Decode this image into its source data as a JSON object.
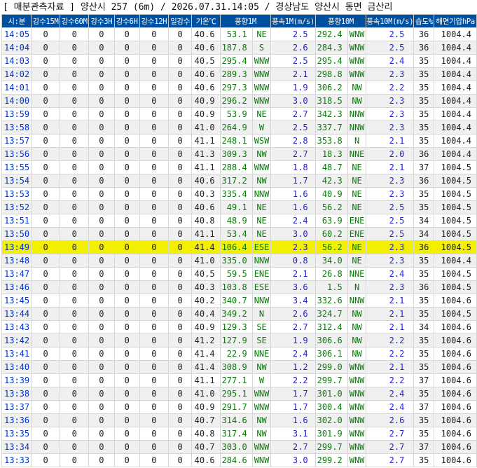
{
  "title": "[ 매분관측자료 ] 양산시 257 (6m) / 2026.07.31.14:05 / 경상남도 양산시 동면 금산리",
  "headers": [
    "시:분",
    "강수15M",
    "강수60M",
    "강수3H",
    "강수6H",
    "강수12H",
    "일강수",
    "기온℃",
    "풍향1M",
    "풍속1M(m/s)",
    "풍향10M",
    "풍속10M(m/s)",
    "습도%",
    "해면기압hPa"
  ],
  "highlight_time": "13:49",
  "rows": [
    [
      "14:05",
      "0",
      "0",
      "0",
      "0",
      "0",
      "0",
      "40.6",
      "53.1",
      "NE",
      "2.5",
      "292.4",
      "WNW",
      "2.5",
      "36",
      "1004.4"
    ],
    [
      "14:04",
      "0",
      "0",
      "0",
      "0",
      "0",
      "0",
      "40.6",
      "187.8",
      "S",
      "2.6",
      "284.3",
      "WNW",
      "2.5",
      "36",
      "1004.4"
    ],
    [
      "14:03",
      "0",
      "0",
      "0",
      "0",
      "0",
      "0",
      "40.5",
      "295.4",
      "WNW",
      "2.5",
      "295.4",
      "WNW",
      "2.4",
      "35",
      "1004.4"
    ],
    [
      "14:02",
      "0",
      "0",
      "0",
      "0",
      "0",
      "0",
      "40.6",
      "289.3",
      "WNW",
      "2.1",
      "298.8",
      "WNW",
      "2.3",
      "35",
      "1004.4"
    ],
    [
      "14:01",
      "0",
      "0",
      "0",
      "0",
      "0",
      "0",
      "40.6",
      "297.3",
      "WNW",
      "1.9",
      "306.2",
      "NW",
      "2.2",
      "35",
      "1004.4"
    ],
    [
      "14:00",
      "0",
      "0",
      "0",
      "0",
      "0",
      "0",
      "40.9",
      "296.2",
      "WNW",
      "3.0",
      "318.5",
      "NW",
      "2.3",
      "35",
      "1004.4"
    ],
    [
      "13:59",
      "0",
      "0",
      "0",
      "0",
      "0",
      "0",
      "40.9",
      "53.9",
      "NE",
      "2.7",
      "342.3",
      "NNW",
      "2.3",
      "35",
      "1004.4"
    ],
    [
      "13:58",
      "0",
      "0",
      "0",
      "0",
      "0",
      "0",
      "41.0",
      "264.9",
      "W",
      "2.5",
      "337.7",
      "NNW",
      "2.3",
      "35",
      "1004.4"
    ],
    [
      "13:57",
      "0",
      "0",
      "0",
      "0",
      "0",
      "0",
      "41.1",
      "248.1",
      "WSW",
      "2.8",
      "353.8",
      "N",
      "2.1",
      "35",
      "1004.4"
    ],
    [
      "13:56",
      "0",
      "0",
      "0",
      "0",
      "0",
      "0",
      "41.3",
      "309.3",
      "NW",
      "2.7",
      "18.3",
      "NNE",
      "2.0",
      "36",
      "1004.4"
    ],
    [
      "13:55",
      "0",
      "0",
      "0",
      "0",
      "0",
      "0",
      "41.1",
      "288.4",
      "WNW",
      "1.8",
      "48.7",
      "NE",
      "2.1",
      "37",
      "1004.5"
    ],
    [
      "13:54",
      "0",
      "0",
      "0",
      "0",
      "0",
      "0",
      "40.6",
      "317.2",
      "NW",
      "1.7",
      "42.3",
      "NE",
      "2.3",
      "36",
      "1004.5"
    ],
    [
      "13:53",
      "0",
      "0",
      "0",
      "0",
      "0",
      "0",
      "40.3",
      "335.4",
      "NNW",
      "1.6",
      "40.9",
      "NE",
      "2.3",
      "35",
      "1004.5"
    ],
    [
      "13:52",
      "0",
      "0",
      "0",
      "0",
      "0",
      "0",
      "40.6",
      "49.1",
      "NE",
      "1.6",
      "56.2",
      "NE",
      "2.5",
      "35",
      "1004.5"
    ],
    [
      "13:51",
      "0",
      "0",
      "0",
      "0",
      "0",
      "0",
      "40.8",
      "48.9",
      "NE",
      "2.4",
      "63.9",
      "ENE",
      "2.5",
      "34",
      "1004.5"
    ],
    [
      "13:50",
      "0",
      "0",
      "0",
      "0",
      "0",
      "0",
      "41.1",
      "53.4",
      "NE",
      "3.0",
      "60.2",
      "ENE",
      "2.5",
      "34",
      "1004.5"
    ],
    [
      "13:49",
      "0",
      "0",
      "0",
      "0",
      "0",
      "0",
      "41.4",
      "106.4",
      "ESE",
      "2.3",
      "56.2",
      "NE",
      "2.3",
      "36",
      "1004.5"
    ],
    [
      "13:48",
      "0",
      "0",
      "0",
      "0",
      "0",
      "0",
      "41.0",
      "335.0",
      "NNW",
      "0.8",
      "34.0",
      "NE",
      "2.3",
      "35",
      "1004.4"
    ],
    [
      "13:47",
      "0",
      "0",
      "0",
      "0",
      "0",
      "0",
      "40.5",
      "59.5",
      "ENE",
      "2.1",
      "26.8",
      "NNE",
      "2.4",
      "35",
      "1004.5"
    ],
    [
      "13:46",
      "0",
      "0",
      "0",
      "0",
      "0",
      "0",
      "40.3",
      "103.8",
      "ESE",
      "3.6",
      "1.5",
      "N",
      "2.3",
      "36",
      "1004.5"
    ],
    [
      "13:45",
      "0",
      "0",
      "0",
      "0",
      "0",
      "0",
      "40.2",
      "340.7",
      "NNW",
      "3.4",
      "332.6",
      "NNW",
      "2.1",
      "35",
      "1004.6"
    ],
    [
      "13:44",
      "0",
      "0",
      "0",
      "0",
      "0",
      "0",
      "40.4",
      "349.2",
      "N",
      "2.6",
      "324.7",
      "NW",
      "2.1",
      "35",
      "1004.5"
    ],
    [
      "13:43",
      "0",
      "0",
      "0",
      "0",
      "0",
      "0",
      "40.9",
      "129.3",
      "SE",
      "2.7",
      "312.4",
      "NW",
      "2.1",
      "34",
      "1004.6"
    ],
    [
      "13:42",
      "0",
      "0",
      "0",
      "0",
      "0",
      "0",
      "41.2",
      "127.9",
      "SE",
      "1.9",
      "306.6",
      "NW",
      "2.2",
      "35",
      "1004.6"
    ],
    [
      "13:41",
      "0",
      "0",
      "0",
      "0",
      "0",
      "0",
      "41.4",
      "22.9",
      "NNE",
      "2.4",
      "306.1",
      "NW",
      "2.2",
      "35",
      "1004.6"
    ],
    [
      "13:40",
      "0",
      "0",
      "0",
      "0",
      "0",
      "0",
      "41.4",
      "308.9",
      "NW",
      "1.2",
      "299.0",
      "WNW",
      "2.1",
      "35",
      "1004.6"
    ],
    [
      "13:39",
      "0",
      "0",
      "0",
      "0",
      "0",
      "0",
      "41.1",
      "277.1",
      "W",
      "2.2",
      "299.7",
      "WNW",
      "2.2",
      "37",
      "1004.6"
    ],
    [
      "13:38",
      "0",
      "0",
      "0",
      "0",
      "0",
      "0",
      "41.0",
      "295.1",
      "WNW",
      "1.7",
      "301.0",
      "WNW",
      "2.4",
      "35",
      "1004.6"
    ],
    [
      "13:37",
      "0",
      "0",
      "0",
      "0",
      "0",
      "0",
      "40.9",
      "291.7",
      "WNW",
      "1.7",
      "300.4",
      "WNW",
      "2.4",
      "37",
      "1004.6"
    ],
    [
      "13:36",
      "0",
      "0",
      "0",
      "0",
      "0",
      "0",
      "40.7",
      "314.6",
      "NW",
      "1.6",
      "302.0",
      "WNW",
      "2.6",
      "35",
      "1004.6"
    ],
    [
      "13:35",
      "0",
      "0",
      "0",
      "0",
      "0",
      "0",
      "40.8",
      "317.4",
      "NW",
      "3.1",
      "301.9",
      "WNW",
      "2.7",
      "35",
      "1004.6"
    ],
    [
      "13:34",
      "0",
      "0",
      "0",
      "0",
      "0",
      "0",
      "40.7",
      "303.0",
      "WNW",
      "2.7",
      "299.7",
      "WNW",
      "2.7",
      "37",
      "1004.6"
    ],
    [
      "13:33",
      "0",
      "0",
      "0",
      "0",
      "0",
      "0",
      "40.6",
      "284.6",
      "WNW",
      "3.0",
      "299.2",
      "WNW",
      "2.7",
      "35",
      "1004.6"
    ]
  ]
}
